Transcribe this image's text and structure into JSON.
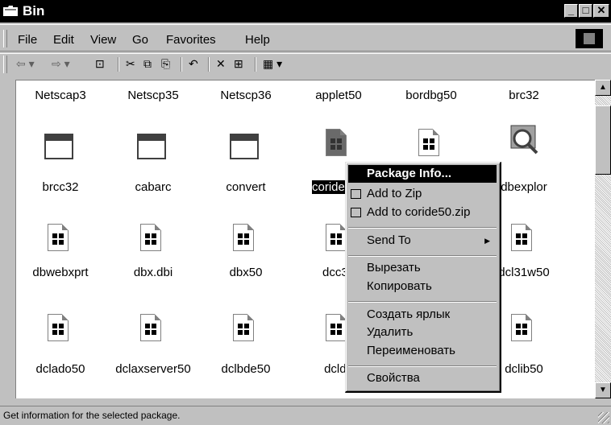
{
  "window": {
    "title": "Bin"
  },
  "menubar": {
    "items": [
      "File",
      "Edit",
      "View",
      "Go",
      "Favorites",
      "Help"
    ]
  },
  "toolbar": {
    "icons": [
      "back-icon",
      "forward-icon",
      "up-folder-icon",
      "cut-icon",
      "copy-icon",
      "paste-icon",
      "undo-icon",
      "delete-icon",
      "properties-icon",
      "views-icon"
    ]
  },
  "files": {
    "row0": [
      "Netscap3",
      "Netscp35",
      "Netscp36",
      "applet50",
      "bordbg50",
      "brc32"
    ],
    "row1": [
      "brcc32",
      "cabarc",
      "convert",
      "coride50",
      "",
      "dbexplor"
    ],
    "row2": [
      "dbwebxprt",
      "dbx.dbi",
      "dbx50",
      "dcc32",
      "",
      "dcl31w50"
    ],
    "row3": [
      "dclado50",
      "dclaxserver50",
      "dclbde50",
      "dcldb",
      "",
      "dclib50"
    ]
  },
  "context_menu": {
    "items": [
      "Package Info...",
      "Add to Zip",
      "Add to coride50.zip",
      "Send To",
      "Вырезать",
      "Копировать",
      "Создать ярлык",
      "Удалить",
      "Переименовать",
      "Свойства"
    ]
  },
  "status": {
    "text": "Get information for the selected package."
  }
}
